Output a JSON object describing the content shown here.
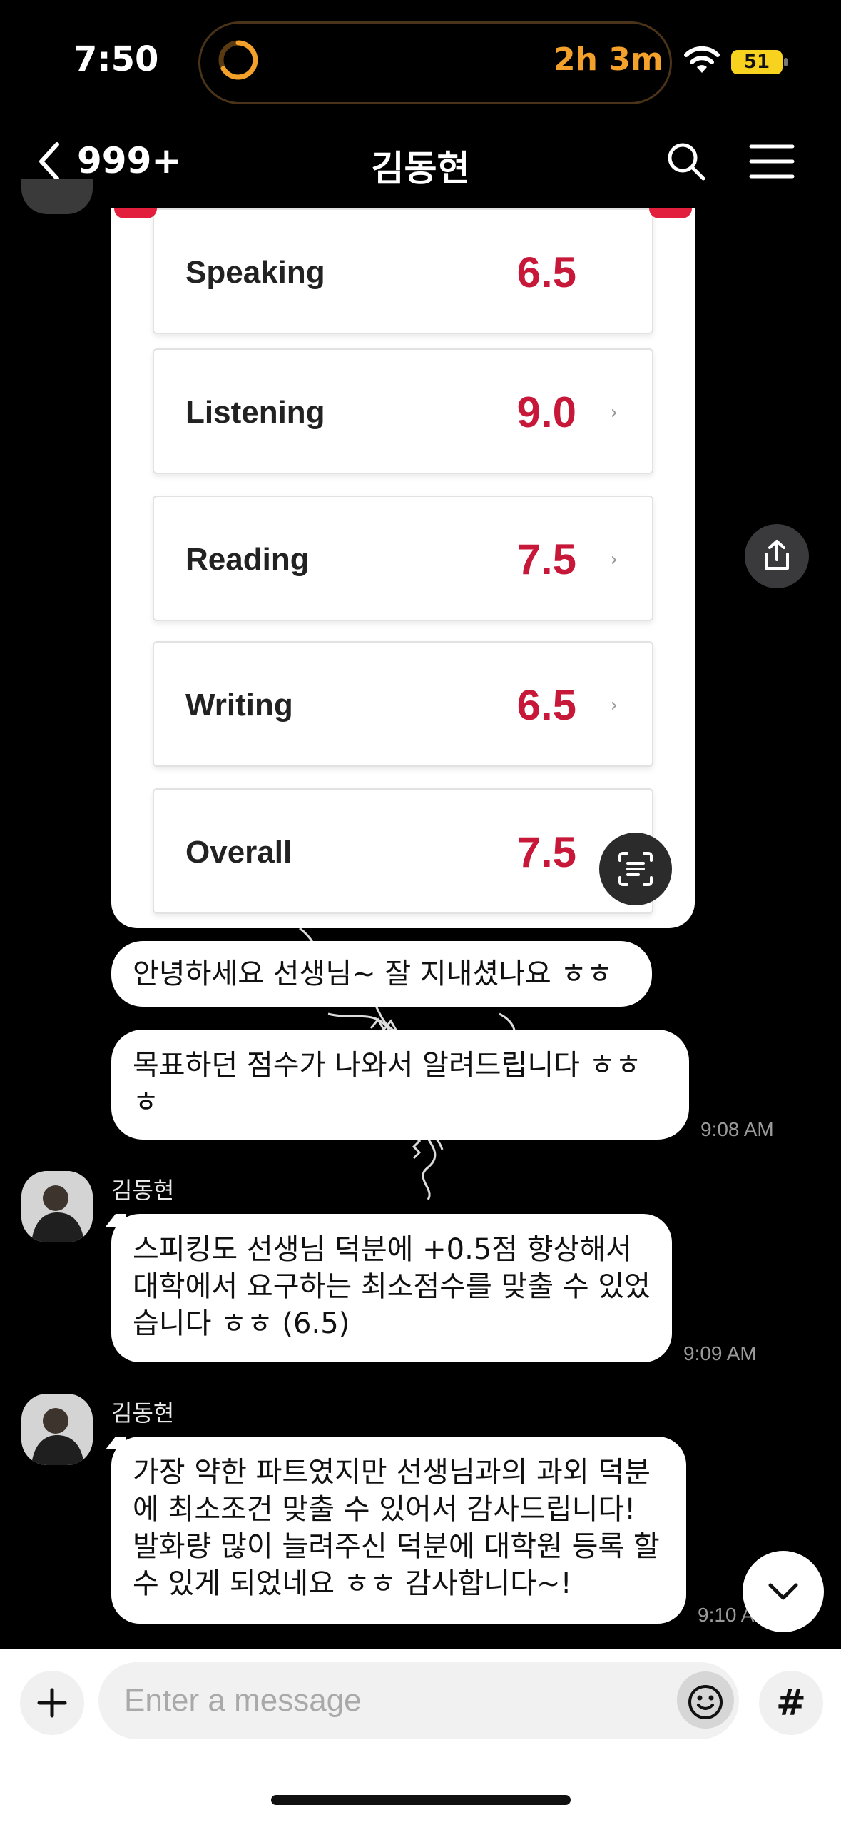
{
  "status_bar": {
    "time": "7:50",
    "timer": "2h 3m",
    "battery": "51"
  },
  "nav": {
    "back_count": "999+",
    "title": "김동현"
  },
  "score_card": {
    "rows": [
      {
        "label": "Speaking",
        "value": "6.5",
        "arrow": ""
      },
      {
        "label": "Listening",
        "value": "9.0",
        "arrow": "›"
      },
      {
        "label": "Reading",
        "value": "7.5",
        "arrow": "›"
      },
      {
        "label": "Writing",
        "value": "6.5",
        "arrow": "›"
      },
      {
        "label": "Overall",
        "value": "7.5",
        "arrow": ""
      }
    ]
  },
  "messages": [
    {
      "text": "안녕하세요 선생님~ 잘 지내셨나요 ㅎㅎ"
    },
    {
      "text": "목표하던 점수가 나와서 알려드립니다 ㅎㅎ ㅎ",
      "time": "9:08 AM"
    },
    {
      "sender": "김동현",
      "text": "스피킹도 선생님 덕분에 +0.5점 향상해서 대학에서 요구하는 최소점수를 맞출 수 있었습니다 ㅎㅎ (6.5)",
      "time": "9:09 AM"
    },
    {
      "sender": "김동현",
      "text": "가장 약한 파트였지만 선생님과의 과외 덕분에 최소조건 맞출 수 있어서 감사드립니다! 발화량 많이 늘려주신 덕분에 대학원 등록 할 수 있게 되었네요 ㅎㅎ 감사합니다~!",
      "time": "9:10 AM"
    }
  ],
  "input": {
    "placeholder": "Enter a message",
    "hash_label": "#"
  },
  "colors": {
    "score_red": "#c8183a",
    "timer_orange": "#f4a12b",
    "battery_yellow": "#f7d21e"
  }
}
